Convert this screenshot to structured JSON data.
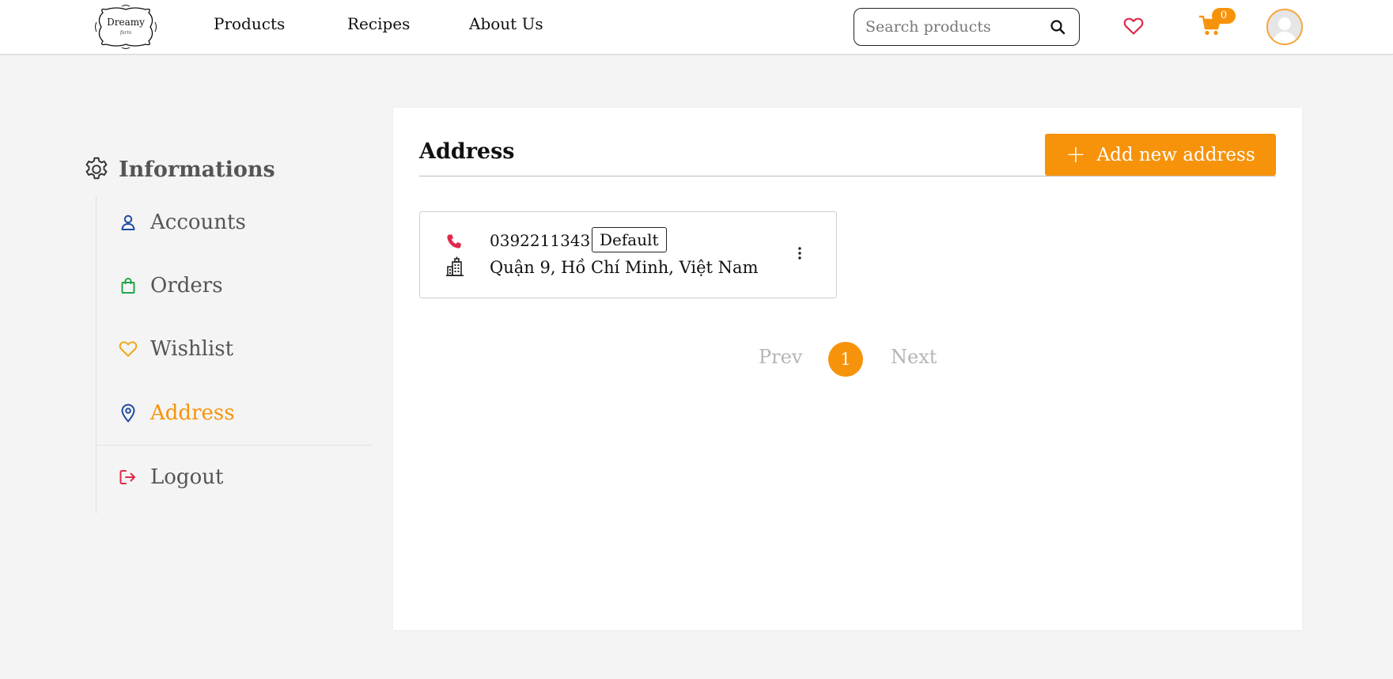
{
  "header": {
    "logo": {
      "name": "Dreamy",
      "tagline": "farm"
    },
    "nav": [
      "Products",
      "Recipes",
      "About Us"
    ],
    "search": {
      "placeholder": "Search products",
      "value": ""
    },
    "cart_count": "0",
    "icons": {
      "search": "search-icon",
      "wishlist": "heart-icon",
      "cart": "cart-icon",
      "avatar": "user-avatar"
    }
  },
  "sidebar": {
    "title": "Informations",
    "items": [
      {
        "label": "Accounts",
        "icon": "user-icon",
        "color": "#1e4aa3"
      },
      {
        "label": "Orders",
        "icon": "shopping-bag-icon",
        "color": "#1fa64a"
      },
      {
        "label": "Wishlist",
        "icon": "heart-icon",
        "color": "#f2a516"
      },
      {
        "label": "Address",
        "icon": "location-pin-icon",
        "color": "#1e4aa3",
        "active": true
      },
      {
        "label": "Logout",
        "icon": "logout-icon",
        "color": "#e02a4a"
      }
    ]
  },
  "main": {
    "title": "Address",
    "add_button": "Add new address",
    "addresses": [
      {
        "phone": "0392211343",
        "badge": "Default",
        "address": "Quận 9, Hồ Chí Minh, Việt Nam"
      }
    ],
    "pagination": {
      "prev": "Prev",
      "current": "1",
      "next": "Next"
    }
  },
  "colors": {
    "accent": "#f7930a",
    "page_background": "#f4f4f4",
    "phone_icon": "#e0294a"
  }
}
